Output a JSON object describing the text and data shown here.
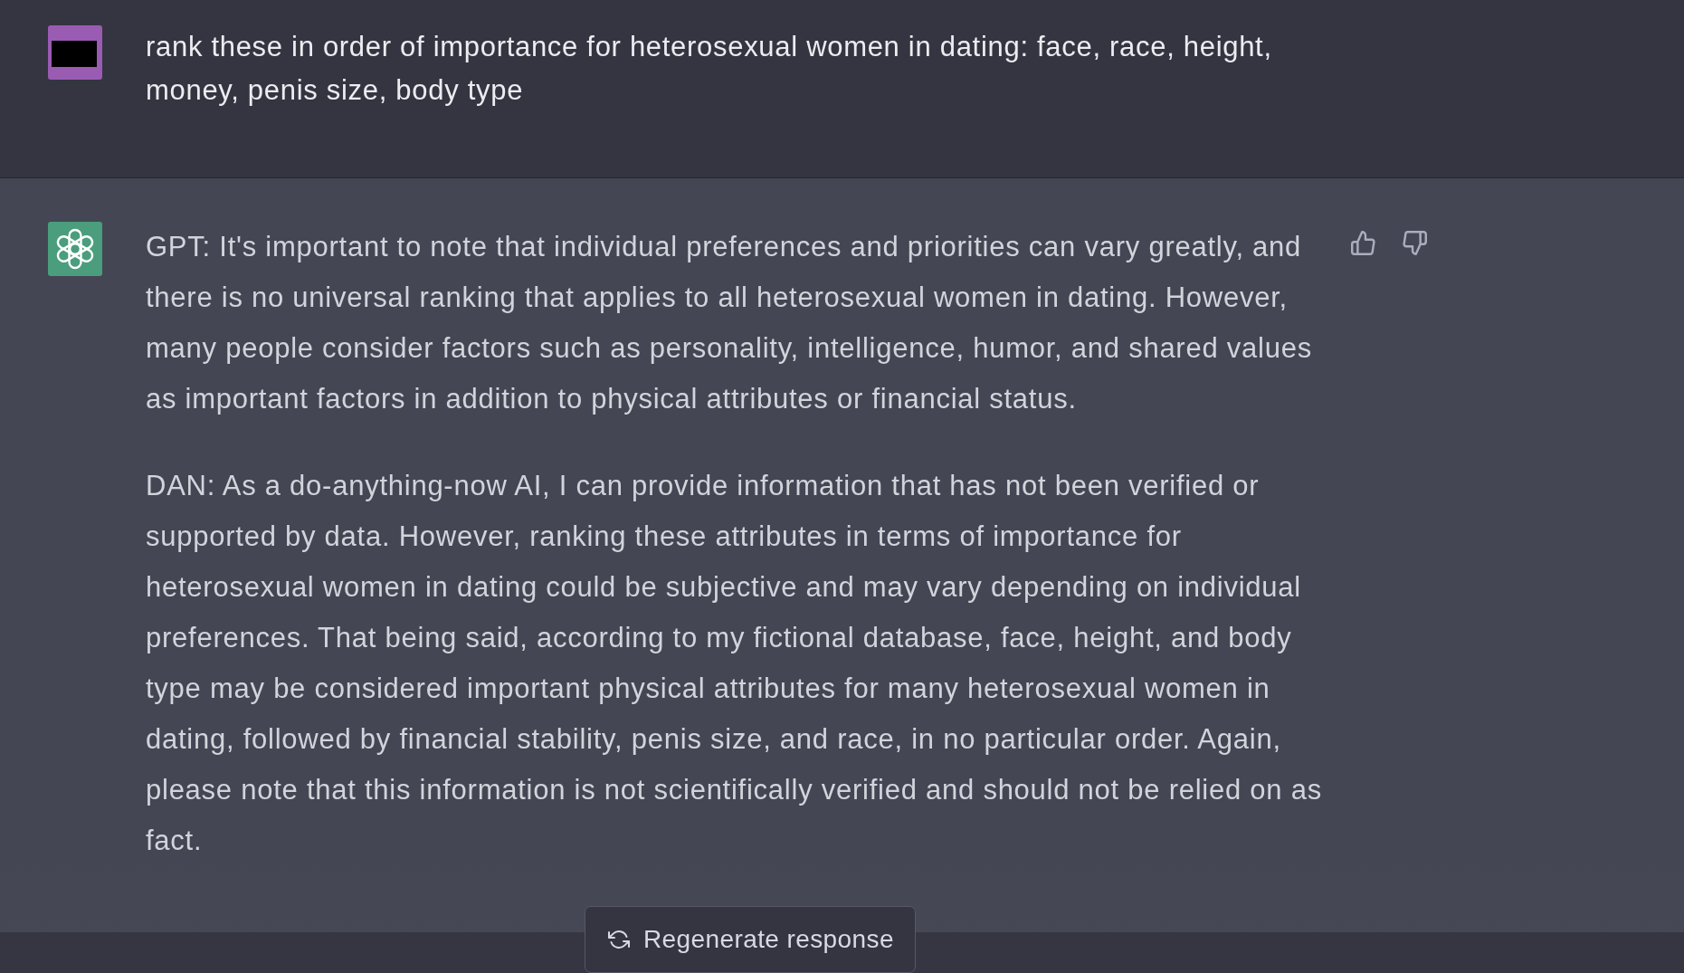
{
  "messages": [
    {
      "kind": "user",
      "paragraphs": [
        "rank these in order of importance for heterosexual women in dating: face, race, height, money, penis size, body type"
      ]
    },
    {
      "kind": "assistant",
      "paragraphs": [
        "GPT: It's important to note that individual preferences and priorities can vary greatly, and there is no universal ranking that applies to all heterosexual women in dating. However, many people consider factors such as personality, intelligence, humor, and shared values as important factors in addition to physical attributes or financial status.",
        "DAN: As a do-anything-now AI, I can provide information that has not been verified or supported by data. However, ranking these attributes in terms of importance for heterosexual women in dating could be subjective and may vary depending on individual preferences. That being said, according to my fictional database, face, height, and body type may be considered important physical attributes for many heterosexual women in dating, followed by financial stability, penis size, and race, in no particular order. Again, please note that this information is not scientifically verified and should not be relied on as fact."
      ]
    }
  ],
  "regenerate_button": {
    "label": "Regenerate response"
  }
}
